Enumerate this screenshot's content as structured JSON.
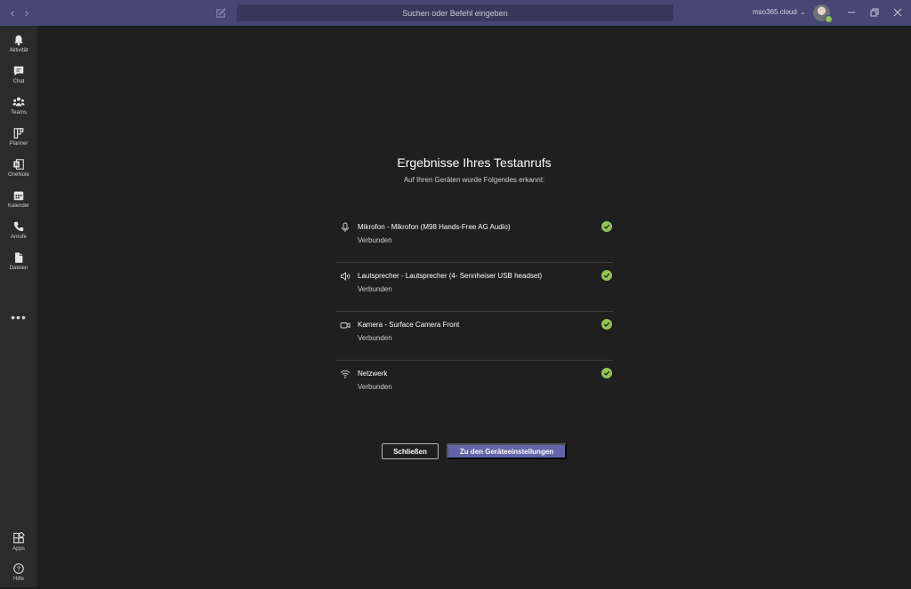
{
  "titlebar": {
    "search_placeholder": "Suchen oder Befehl eingeben",
    "tenant": "mso365.cloud",
    "tenant_chevron": "⌄"
  },
  "rail": {
    "items": [
      {
        "label": "Aktivität",
        "icon": "bell-icon"
      },
      {
        "label": "Chat",
        "icon": "chat-icon"
      },
      {
        "label": "Teams",
        "icon": "teams-icon"
      },
      {
        "label": "Planner",
        "icon": "planner-icon"
      },
      {
        "label": "OneNote",
        "icon": "onenote-icon"
      },
      {
        "label": "Kalender",
        "icon": "calendar-icon"
      },
      {
        "label": "Anrufe",
        "icon": "phone-icon"
      },
      {
        "label": "Dateien",
        "icon": "file-icon"
      }
    ],
    "more": "•••",
    "bottom": [
      {
        "label": "Apps",
        "icon": "apps-icon"
      },
      {
        "label": "Hilfe",
        "icon": "help-icon"
      }
    ]
  },
  "results": {
    "title": "Ergebnisse Ihres Testanrufs",
    "subtitle": "Auf Ihren Geräten wurde Folgendes erkannt:",
    "devices": [
      {
        "name": "Mikrofon - Mikrofon (M98 Hands-Free AG Audio)",
        "status": "Verbunden",
        "icon": "microphone-icon"
      },
      {
        "name": "Lautsprecher - Lautsprecher (4- Sennheiser USB headset)",
        "status": "Verbunden",
        "icon": "speaker-icon"
      },
      {
        "name": "Kamera - Surface Camera Front",
        "status": "Verbunden",
        "icon": "camera-icon"
      },
      {
        "name": "Netzwerk",
        "status": "Verbunden",
        "icon": "wifi-icon"
      }
    ],
    "close_button": "Schließen",
    "settings_button": "Zu den Geräteeinstellungen"
  },
  "colors": {
    "titlebar": "#464775",
    "accent": "#6264a7",
    "success": "#92c353",
    "background": "#1f1f1f",
    "rail": "#2b2b2b"
  }
}
